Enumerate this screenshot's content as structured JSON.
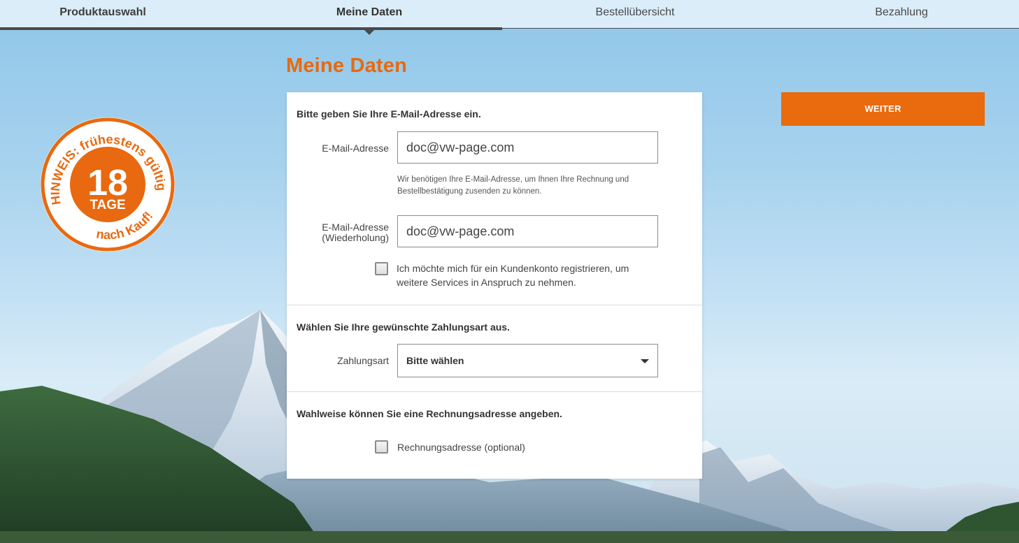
{
  "nav": {
    "steps": [
      {
        "label": "Produktauswahl"
      },
      {
        "label": "Meine Daten"
      },
      {
        "label": "Bestellübersicht"
      },
      {
        "label": "Bezahlung"
      }
    ]
  },
  "page": {
    "title": "Meine Daten",
    "next_button": "WEITER"
  },
  "badge": {
    "number": "18",
    "unit": "TAGE",
    "arc_top": "HINWEIS: frühestens gültig",
    "arc_bottom": "nach Kauf!"
  },
  "form": {
    "email_section": {
      "title": "Bitte geben Sie Ihre E-Mail-Adresse ein.",
      "email_label": "E-Mail-Adresse",
      "email_value": "doc@vw-page.com",
      "hint": "Wir benötigen Ihre E-Mail-Adresse, um Ihnen Ihre Rechnung und Bestellbestätigung zusenden zu können.",
      "repeat_label_line1": "E-Mail-Adresse",
      "repeat_label_line2": "(Wiederholung)",
      "repeat_value": "doc@vw-page.com",
      "account_checkbox_line1": "Ich möchte mich für ein Kundenkonto registrieren, um",
      "account_checkbox_line2": "weitere Services in Anspruch zu nehmen."
    },
    "payment_section": {
      "title": "Wählen Sie Ihre gewünschte Zahlungsart aus.",
      "label": "Zahlungsart",
      "selected": "Bitte wählen"
    },
    "billing_section": {
      "title": "Wahlweise können Sie eine Rechnungsadresse angeben.",
      "checkbox_label": "Rechnungsadresse (optional)"
    }
  },
  "colors": {
    "accent": "#ea6a0e",
    "text": "#444444",
    "nav_bar": "#4a4a4a"
  }
}
